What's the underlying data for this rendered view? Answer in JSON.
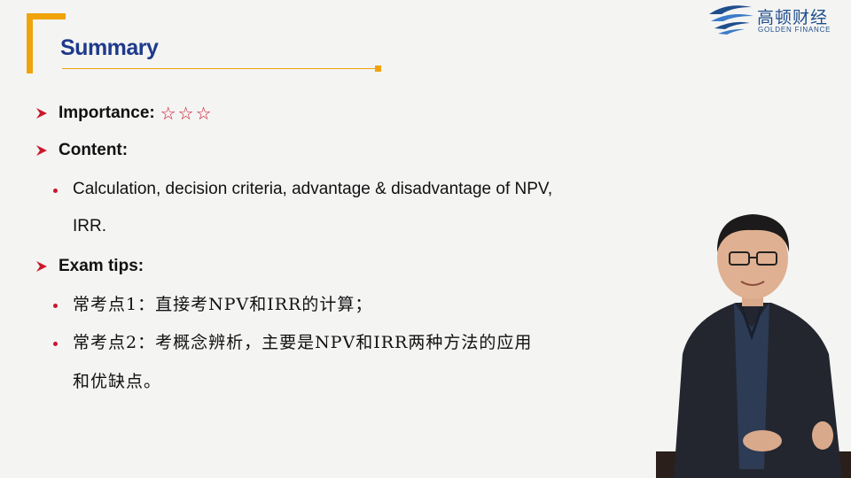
{
  "slide": {
    "title": "Summary",
    "logo_cn": "高顿财经",
    "logo_en": "GOLDEN FINANCE",
    "importance_label": "Importance:",
    "importance_stars": "☆☆☆",
    "content_label": "Content:",
    "content_bullet_line1": "Calculation, decision criteria, advantage & disadvantage of NPV,",
    "content_bullet_line2": "IRR.",
    "exam_label": "Exam tips:",
    "tip1": "常考点1：直接考NPV和IRR的计算；",
    "tip2_line1": "常考点2：考概念辨析，主要是NPV和IRR两种方法的应用",
    "tip2_line2": "和优缺点。"
  },
  "colors": {
    "accent_orange": "#f0a30a",
    "title_blue": "#1e3a8a",
    "bullet_red": "#c9182b",
    "background": "#f4f4f3"
  }
}
